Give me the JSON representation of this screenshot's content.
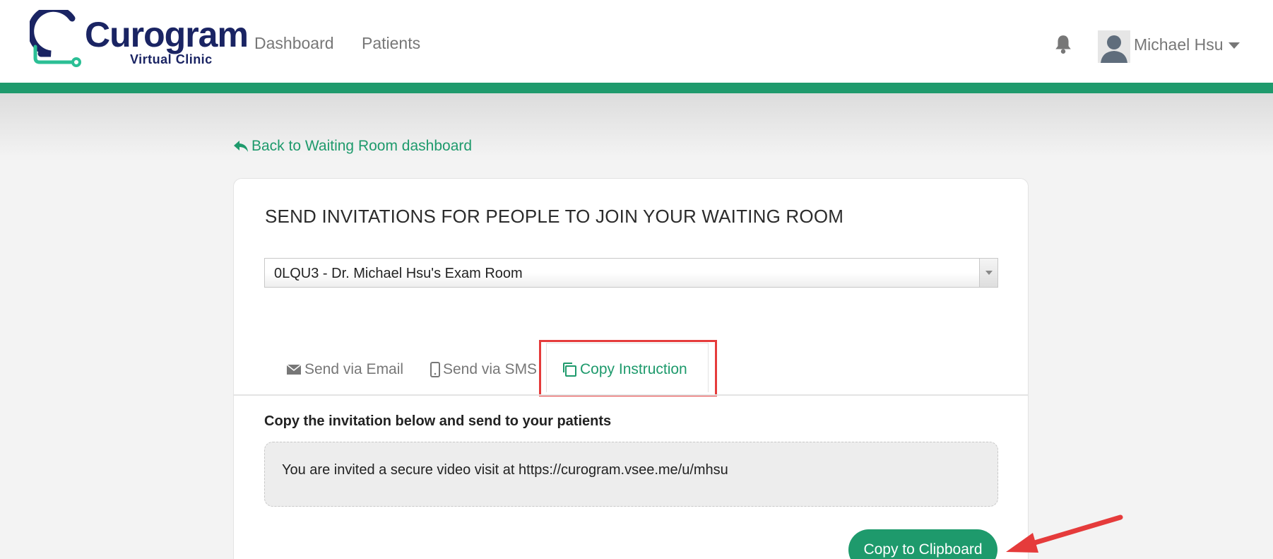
{
  "brand": {
    "name": "Curogram",
    "subtitle": "Virtual Clinic",
    "colors": {
      "brand": "#1a2463",
      "accent": "#1e9a6c",
      "highlight": "#e53b3b"
    }
  },
  "nav": {
    "items": [
      {
        "label": "Dashboard"
      },
      {
        "label": "Patients"
      }
    ]
  },
  "user": {
    "name": "Michael Hsu",
    "icons": [
      "bell-icon",
      "avatar",
      "caret-down-icon"
    ]
  },
  "back_link": {
    "label": "Back to Waiting Room dashboard",
    "icon": "reply-arrow-icon"
  },
  "card": {
    "title": "SEND INVITATIONS FOR PEOPLE TO JOIN YOUR WAITING ROOM",
    "room_select": {
      "value": "0LQU3 - Dr. Michael Hsu's Exam Room"
    },
    "tabs": [
      {
        "label": "Send via Email",
        "icon": "envelope-icon",
        "active": false
      },
      {
        "label": "Send via SMS",
        "icon": "mobile-icon",
        "active": false
      },
      {
        "label": "Copy Instruction",
        "icon": "copy-icon",
        "active": true
      }
    ],
    "copy_label": "Copy the invitation below and send to your patients",
    "invitation_text": "You are invited a secure video visit at https://curogram.vsee.me/u/mhsu",
    "copy_button": "Copy to Clipboard"
  }
}
